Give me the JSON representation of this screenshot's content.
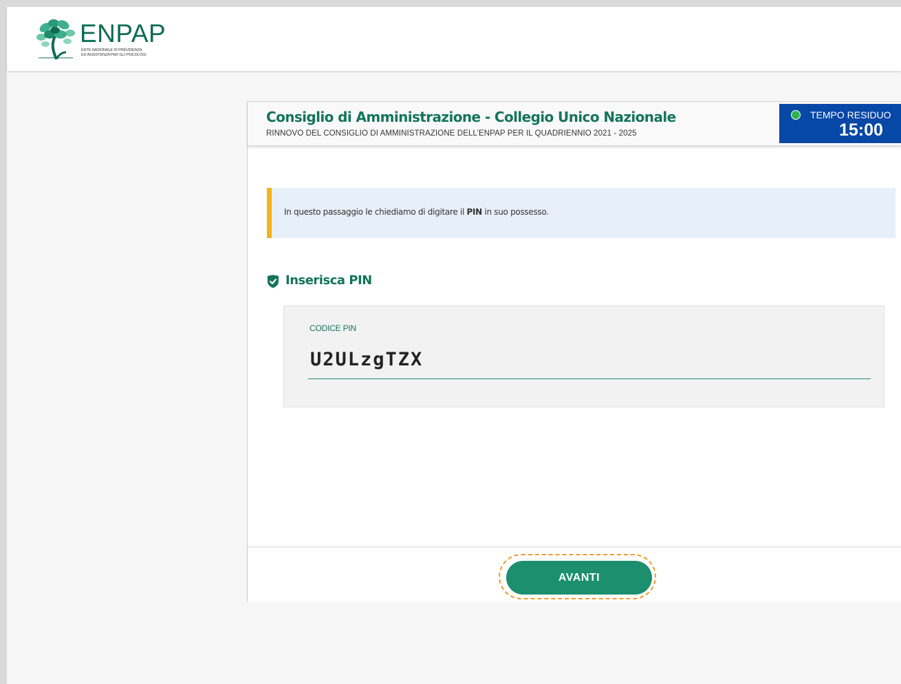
{
  "header": {
    "logo": {
      "title": "ENPAP",
      "subtitle": "ENTE NAZIONALE DI PREVIDENZA\nED ASSISTENZA PER GLI PSICOLOGI",
      "icon": "tree-logo-icon",
      "color": "#0e6b51"
    }
  },
  "card": {
    "title": "Consiglio di Amministrazione - Collegio Unico Nazionale",
    "subtitle": "RINNOVO DEL CONSIGLIO DI AMMINISTRAZIONE DELL’ENPAP PER IL QUADRIENNIO  2021 - 2025",
    "timer": {
      "label": "TEMPO RESIDUO",
      "value": "15:00",
      "status_icon": "status-dot-icon",
      "status_color": "#2fb34f",
      "background": "#0747a6"
    },
    "notice": {
      "text_before": "In questo passaggio le chiediamo di digitare il ",
      "text_bold": "PIN",
      "text_after": " in suo possesso.",
      "accent_color": "#f5b21a"
    },
    "section": {
      "title": "Inserisca PIN",
      "icon": "shield-check-icon"
    },
    "pin_field": {
      "label": "CODICE PIN",
      "value": "U2ULzgTZX"
    },
    "footer": {
      "next_label": "AVANTI"
    }
  },
  "colors": {
    "brand": "#14745a",
    "button": "#1c8f6e",
    "focus_outline": "#f29a28"
  }
}
